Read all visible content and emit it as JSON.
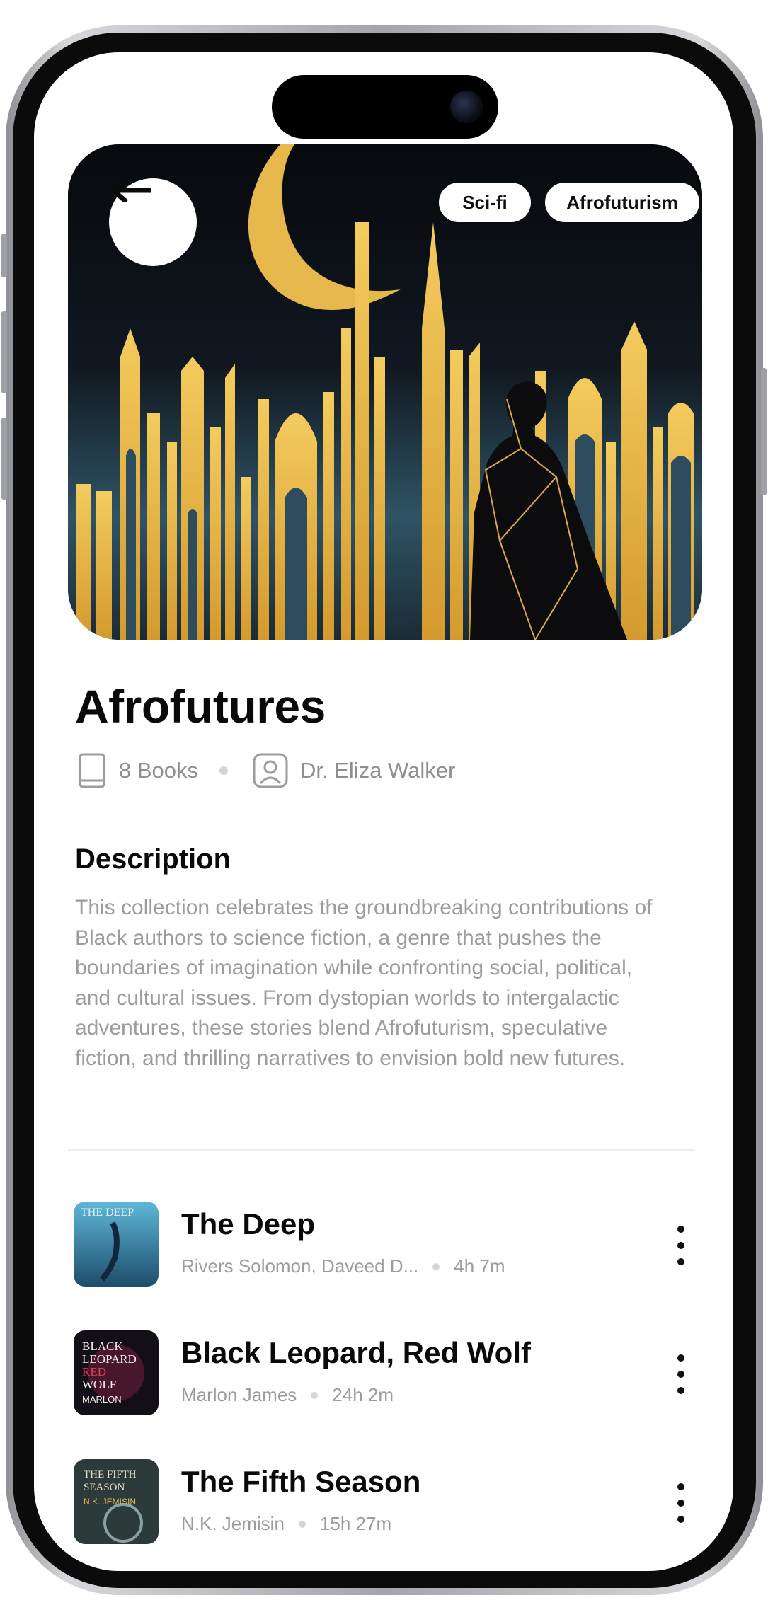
{
  "header": {
    "tags": [
      "Sci-fi",
      "Afrofuturism"
    ]
  },
  "collection": {
    "title": "Afrofutures",
    "books_count": "8 Books",
    "curator": "Dr. Eliza Walker"
  },
  "description": {
    "heading": "Description",
    "text": "This collection celebrates the groundbreaking contributions of Black authors to science fiction, a genre that pushes the boundaries of imagination while confronting social, political, and cultural issues. From dystopian worlds to intergalactic adventures, these stories blend Afrofuturism, speculative fiction, and thrilling narratives to envision bold new futures."
  },
  "books": [
    {
      "title": "The Deep",
      "authors": "Rivers Solomon, Daveed D...",
      "duration": "4h 7m",
      "cover_text": "THE DEEP"
    },
    {
      "title": "Black Leopard, Red Wolf",
      "authors": "Marlon James",
      "duration": "24h 2m",
      "cover_text": "BLACK LEOPARD RED WOLF MARLON JAMES"
    },
    {
      "title": "The Fifth Season",
      "authors": "N.K. Jemisin",
      "duration": "15h 27m",
      "cover_text": "THE FIFTH SEASON N.K. JEMISIN"
    }
  ],
  "icons": {
    "back": "arrow-left-icon",
    "books": "book-icon",
    "curator": "user-icon",
    "more": "more-vertical-icon"
  },
  "colors": {
    "gold": "#e8b84a",
    "teal": "#3f6a7c",
    "muted_text": "#9b9ba0"
  }
}
